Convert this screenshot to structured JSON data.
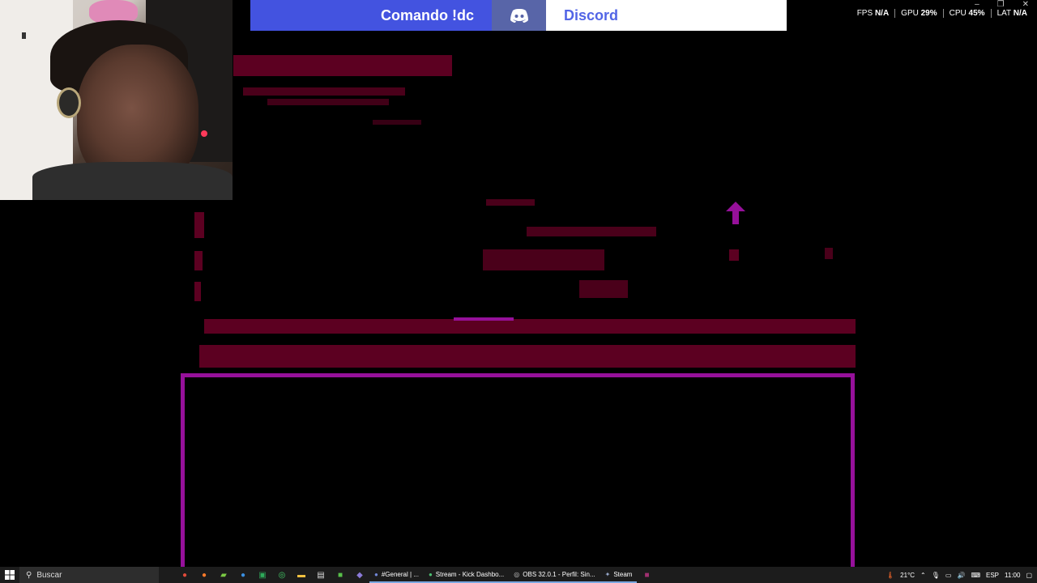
{
  "banner": {
    "command": "Comando !dc",
    "name": "Discord",
    "accent": "#4353e0"
  },
  "stats": [
    {
      "label": "FPS",
      "value": "N/A"
    },
    {
      "label": "GPU",
      "value": "29%"
    },
    {
      "label": "CPU",
      "value": "45%"
    },
    {
      "label": "LAT",
      "value": "N/A"
    }
  ],
  "colors": {
    "game_bar": "#5c0021",
    "frame": "#96109a",
    "arrow": "#96109a"
  },
  "taskbar": {
    "search_label": "Buscar",
    "tasks": [
      {
        "label": "#General | ...",
        "icon": "discord-icon"
      },
      {
        "label": "Stream - Kick Dashbo...",
        "icon": "chrome-icon"
      },
      {
        "label": "OBS 32.0.1 - Perfil: Sin...",
        "icon": "obs-icon"
      },
      {
        "label": "Steam",
        "icon": "steam-icon"
      }
    ],
    "weather": "21°C",
    "language": "ESP",
    "time": "11:00"
  }
}
